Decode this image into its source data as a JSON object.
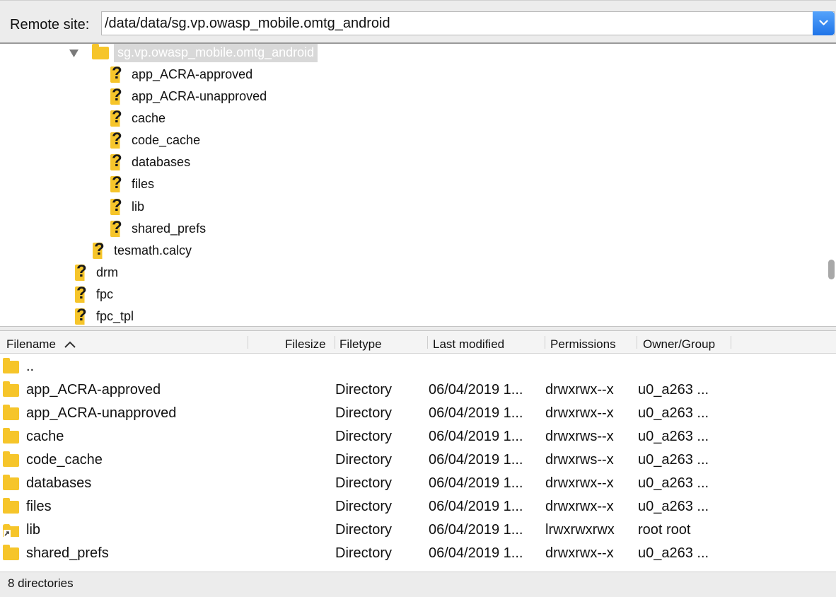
{
  "remote": {
    "label": "Remote site:",
    "path": "/data/data/sg.vp.owasp_mobile.omtg_android"
  },
  "tree": {
    "selected": "sg.vp.owasp_mobile.omtg_android",
    "children": [
      {
        "label": "app_ACRA-approved"
      },
      {
        "label": "app_ACRA-unapproved"
      },
      {
        "label": "cache"
      },
      {
        "label": "code_cache"
      },
      {
        "label": "databases"
      },
      {
        "label": "files"
      },
      {
        "label": "lib"
      },
      {
        "label": "shared_prefs"
      }
    ],
    "siblings": [
      {
        "label": "tesmath.calcy"
      }
    ],
    "top": [
      {
        "label": "drm"
      },
      {
        "label": "fpc"
      },
      {
        "label": "fpc_tpl"
      }
    ]
  },
  "list": {
    "columns": {
      "filename": "Filename",
      "filesize": "Filesize",
      "filetype": "Filetype",
      "modified": "Last modified",
      "permissions": "Permissions",
      "owner": "Owner/Group"
    },
    "parent": "..",
    "rows": [
      {
        "name": "app_ACRA-approved",
        "type": "Directory",
        "modified": "06/04/2019 1...",
        "perms": "drwxrwx--x",
        "owner": "u0_a263 ..."
      },
      {
        "name": "app_ACRA-unapproved",
        "type": "Directory",
        "modified": "06/04/2019 1...",
        "perms": "drwxrwx--x",
        "owner": "u0_a263 ..."
      },
      {
        "name": "cache",
        "type": "Directory",
        "modified": "06/04/2019 1...",
        "perms": "drwxrws--x",
        "owner": "u0_a263 ..."
      },
      {
        "name": "code_cache",
        "type": "Directory",
        "modified": "06/04/2019 1...",
        "perms": "drwxrws--x",
        "owner": "u0_a263 ..."
      },
      {
        "name": "databases",
        "type": "Directory",
        "modified": "06/04/2019 1...",
        "perms": "drwxrwx--x",
        "owner": "u0_a263 ..."
      },
      {
        "name": "files",
        "type": "Directory",
        "modified": "06/04/2019 1...",
        "perms": "drwxrwx--x",
        "owner": "u0_a263 ..."
      },
      {
        "name": "lib",
        "type": "Directory",
        "modified": "06/04/2019 1...",
        "perms": "lrwxrwxrwx",
        "owner": "root root",
        "symlink": true
      },
      {
        "name": "shared_prefs",
        "type": "Directory",
        "modified": "06/04/2019 1...",
        "perms": "drwxrwx--x",
        "owner": "u0_a263 ..."
      }
    ]
  },
  "status": {
    "text": "8 directories"
  },
  "colors": {
    "folder": "#f6c52a",
    "accent": "#1f74e8"
  }
}
